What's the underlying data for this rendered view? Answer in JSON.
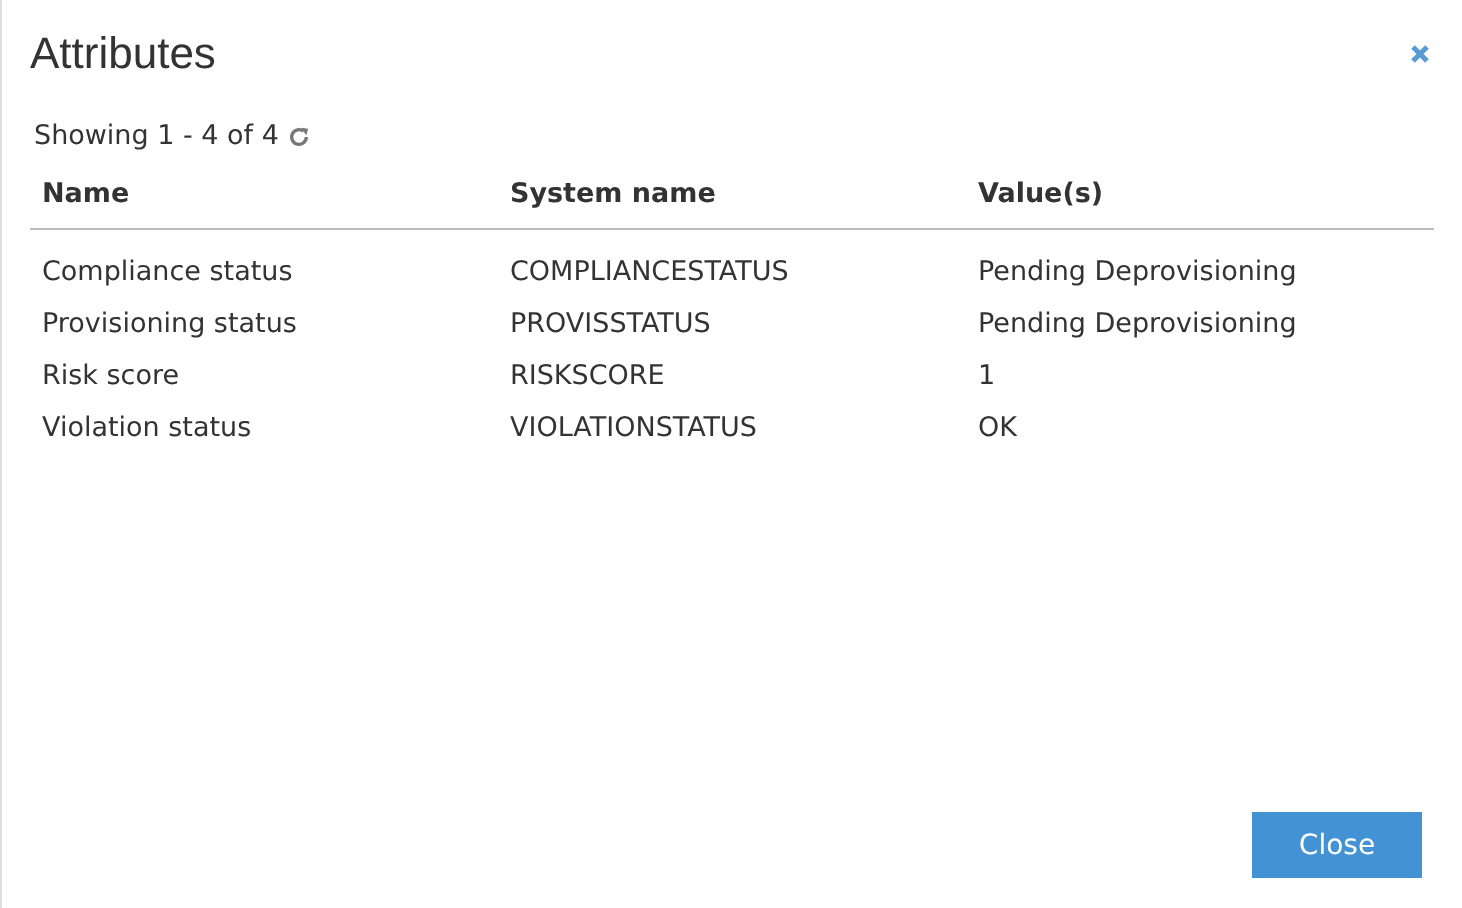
{
  "dialog": {
    "title": "Attributes"
  },
  "summary": "Showing 1 - 4 of 4",
  "table": {
    "columns": [
      "Name",
      "System name",
      "Value(s)"
    ],
    "rows": [
      [
        "Compliance status",
        "COMPLIANCESTATUS",
        "Pending Deprovisioning"
      ],
      [
        "Provisioning status",
        "PROVISSTATUS",
        "Pending Deprovisioning"
      ],
      [
        "Risk score",
        "RISKSCORE",
        "1"
      ],
      [
        "Violation status",
        "VIOLATIONSTATUS",
        "OK"
      ]
    ]
  },
  "buttons": [
    "Close"
  ]
}
